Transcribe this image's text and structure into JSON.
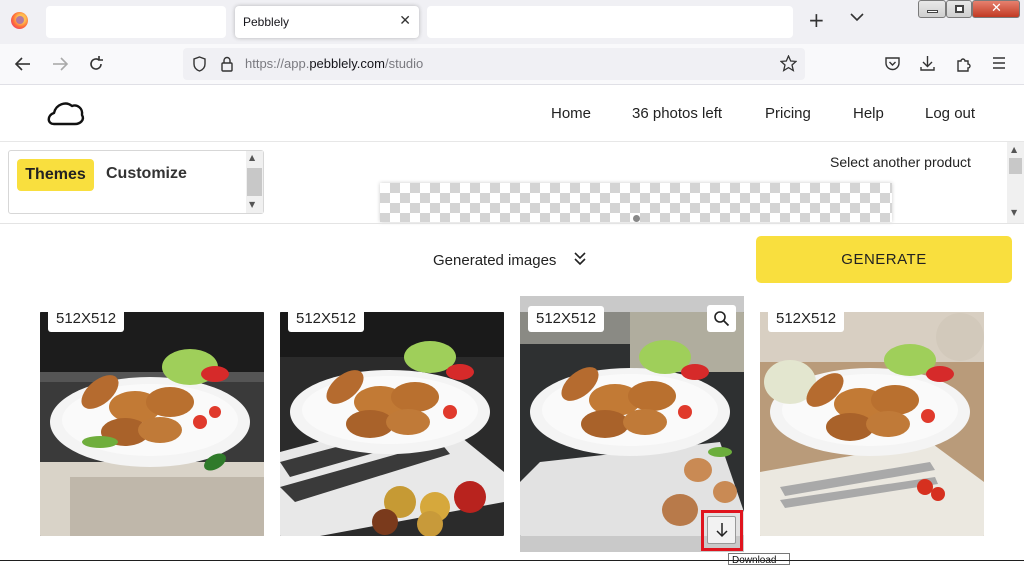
{
  "browser": {
    "tabs": [
      {
        "title": ""
      },
      {
        "title": "Pebblely",
        "active": true
      },
      {
        "title": ""
      }
    ],
    "url_prefix": "https://app.",
    "url_domain": "pebblely.com",
    "url_path": "/studio"
  },
  "header": {
    "nav": [
      "Home",
      "36 photos left",
      "Pricing",
      "Help",
      "Log out"
    ]
  },
  "themes_panel": {
    "themes_label": "Themes",
    "customize_label": "Customize"
  },
  "select_another": "Select another product",
  "generated_label": "Generated images",
  "generate_label": "GENERATE",
  "images": [
    {
      "dim": "512X512"
    },
    {
      "dim": "512X512"
    },
    {
      "dim": "512X512"
    },
    {
      "dim": "512X512"
    }
  ],
  "tooltip": "Download",
  "colors": {
    "accent_yellow": "#f9df3e",
    "highlight_red": "#e0141e"
  }
}
